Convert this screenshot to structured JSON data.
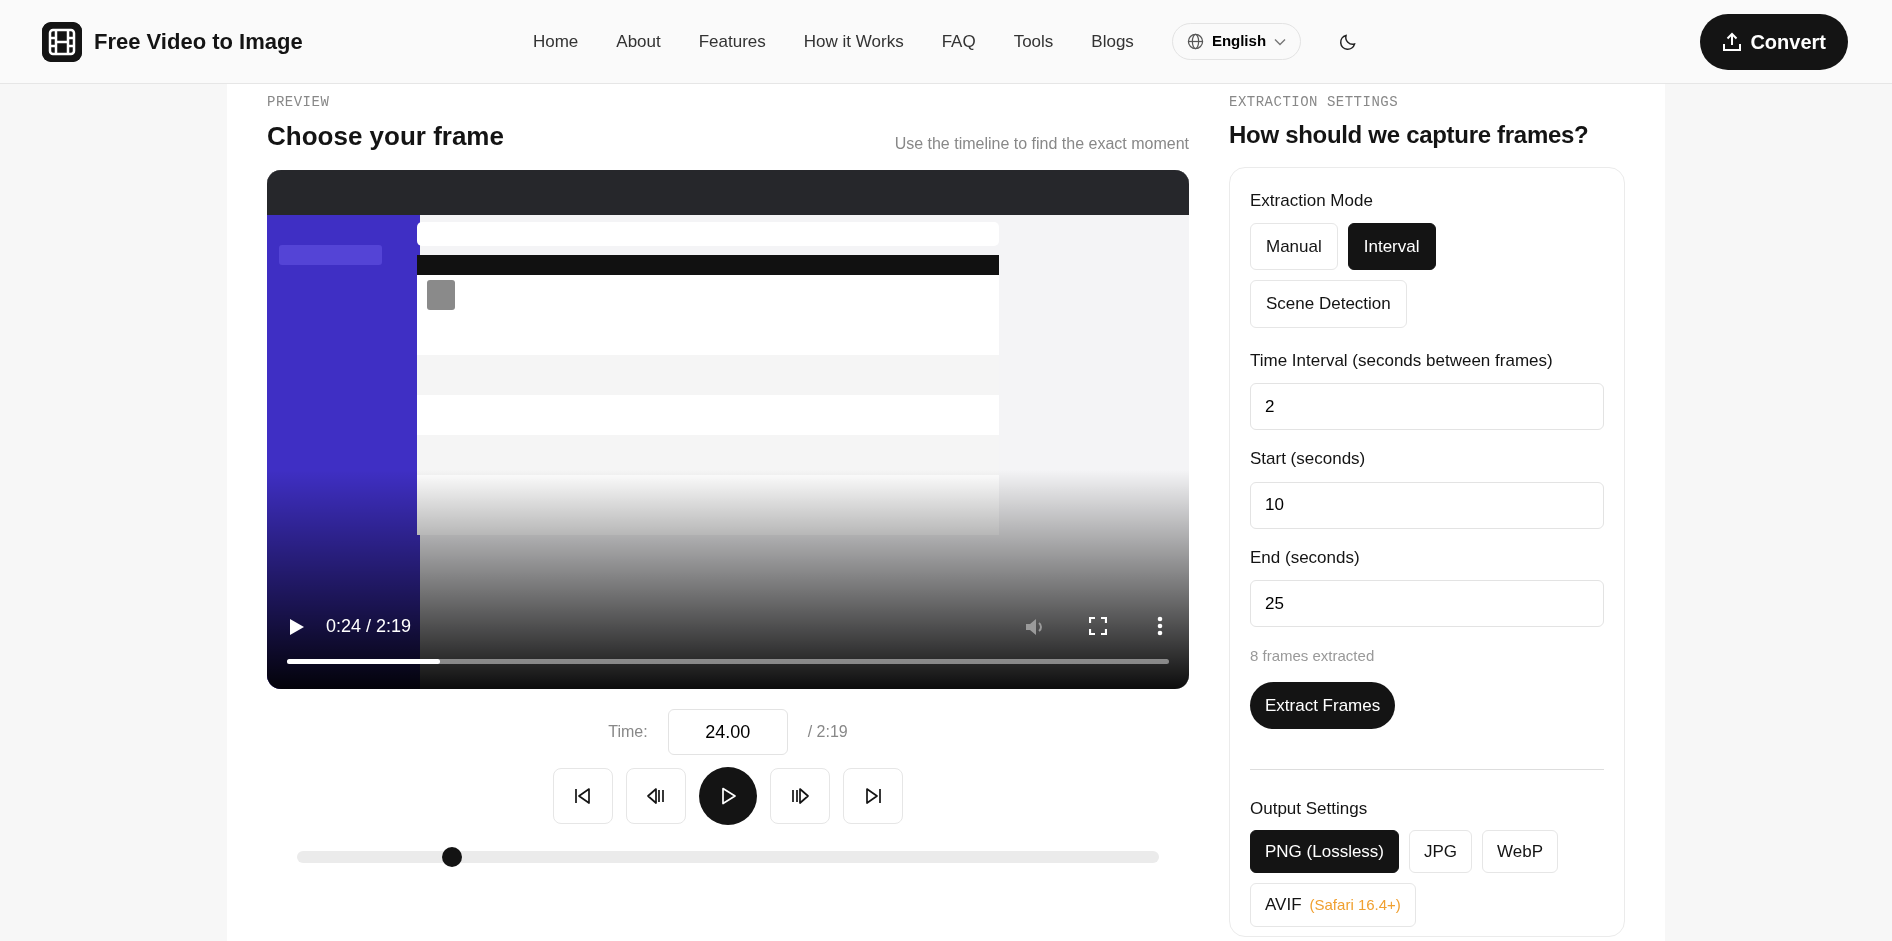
{
  "header": {
    "brand": "Free Video to Image",
    "nav": [
      "Home",
      "About",
      "Features",
      "How it Works",
      "FAQ",
      "Tools",
      "Blogs"
    ],
    "language": "English",
    "convert": "Convert"
  },
  "preview": {
    "eyebrow": "PREVIEW",
    "title": "Choose your frame",
    "hint": "Use the timeline to find the exact moment",
    "video": {
      "time": "0:24 / 2:19",
      "level": 0.173
    },
    "time_label": "Time:",
    "time_value": "24.00",
    "duration": "/ 2:19",
    "controls": [
      {
        "kind": "first"
      },
      {
        "kind": "prev"
      },
      {
        "kind": "play"
      },
      {
        "kind": "next"
      },
      {
        "kind": "last"
      }
    ],
    "scrubber": {
      "level": 0.18
    }
  },
  "settings": {
    "eyebrow": "EXTRACTION SETTINGS",
    "title": "How should we capture frames?",
    "mode_label": "Extraction Mode",
    "modes": [
      {
        "label": "Manual",
        "selected": false
      },
      {
        "label": "Interval",
        "selected": true
      },
      {
        "label": "Scene Detection",
        "selected": false
      }
    ],
    "fields": [
      {
        "label": "Time Interval (seconds between frames)",
        "value": "2"
      },
      {
        "label": "Start (seconds)",
        "value": "10"
      },
      {
        "label": "End (seconds)",
        "value": "25"
      }
    ],
    "frames_note": "8 frames extracted",
    "extract": "Extract Frames",
    "output_label": "Output Settings",
    "formats": [
      {
        "label": "PNG (Lossless)",
        "selected": true
      },
      {
        "label": "JPG",
        "selected": false
      },
      {
        "label": "WebP",
        "selected": false
      },
      {
        "label": "AVIF",
        "selected": false,
        "note": "(Safari 16.4+)"
      }
    ]
  }
}
